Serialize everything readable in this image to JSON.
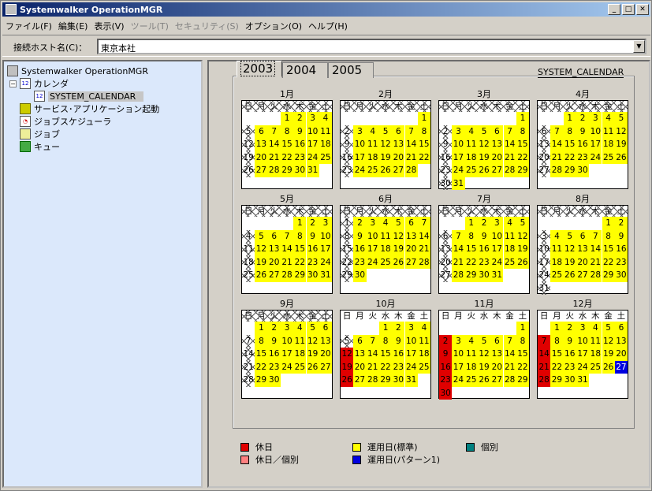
{
  "titlebar": {
    "title": "Systemwalker OperationMGR",
    "min": "_",
    "max": "□",
    "close": "✕"
  },
  "menu": [
    {
      "label": "ファイル(F)",
      "enabled": true
    },
    {
      "label": "編集(E)",
      "enabled": true
    },
    {
      "label": "表示(V)",
      "enabled": true
    },
    {
      "label": "ツール(T)",
      "enabled": false
    },
    {
      "label": "セキュリティ(S)",
      "enabled": false
    },
    {
      "label": "オプション(O)",
      "enabled": true
    },
    {
      "label": "ヘルプ(H)",
      "enabled": true
    }
  ],
  "host": {
    "label": "接続ホスト名(C)：",
    "value": "東京本社"
  },
  "tree": [
    {
      "label": "Systemwalker OperationMGR",
      "icon": "computer-icon"
    },
    {
      "label": "カレンダ",
      "icon": "calendar-icon"
    },
    {
      "label": "SYSTEM_CALENDAR",
      "icon": "calendar-icon",
      "selected": true
    },
    {
      "label": "サービス･アプリケーション起動",
      "icon": "gear-icon"
    },
    {
      "label": "ジョブスケジューラ",
      "icon": "scheduler-icon"
    },
    {
      "label": "ジョブ",
      "icon": "job-icon"
    },
    {
      "label": "キュー",
      "icon": "queue-icon"
    }
  ],
  "tabs": [
    "2003",
    "2004",
    "2005"
  ],
  "active_tab": "2003",
  "calendar_name": "SYSTEM_CALENDAR",
  "weekdays": [
    "日",
    "月",
    "火",
    "水",
    "木",
    "金",
    "土"
  ],
  "months": [
    {
      "title": "1月",
      "start": 3,
      "days": 31,
      "past_through": 31
    },
    {
      "title": "2月",
      "start": 6,
      "days": 28,
      "past_through": 28
    },
    {
      "title": "3月",
      "start": 6,
      "days": 31,
      "past_through": 31
    },
    {
      "title": "4月",
      "start": 2,
      "days": 30,
      "past_through": 30
    },
    {
      "title": "5月",
      "start": 4,
      "days": 31,
      "past_through": 31
    },
    {
      "title": "6月",
      "start": 0,
      "days": 30,
      "past_through": 30
    },
    {
      "title": "7月",
      "start": 2,
      "days": 31,
      "past_through": 31
    },
    {
      "title": "8月",
      "start": 5,
      "days": 31,
      "past_through": 31
    },
    {
      "title": "9月",
      "start": 1,
      "days": 30,
      "past_through": 30
    },
    {
      "title": "10月",
      "start": 3,
      "days": 31,
      "past_through": 5
    },
    {
      "title": "11月",
      "start": 6,
      "days": 30,
      "past_through": 0
    },
    {
      "title": "12月",
      "start": 1,
      "days": 31,
      "past_through": 0
    }
  ],
  "day_status": {
    "10": {
      "holiday": [
        12,
        19,
        26
      ]
    },
    "11": {
      "holiday": [
        2,
        9,
        16,
        23,
        30
      ]
    },
    "12": {
      "holiday": [
        7,
        14,
        21,
        28
      ],
      "pattern1": [
        27
      ]
    }
  },
  "legend": [
    {
      "label": "休日",
      "color": "#e00000"
    },
    {
      "label": "運用日(標準)",
      "color": "#ffff00"
    },
    {
      "label": "個別",
      "color": "#008080"
    },
    {
      "label": "休日／個別",
      "color": "#ff8080"
    },
    {
      "label": "運用日(パターン1)",
      "color": "#0000e0"
    }
  ]
}
